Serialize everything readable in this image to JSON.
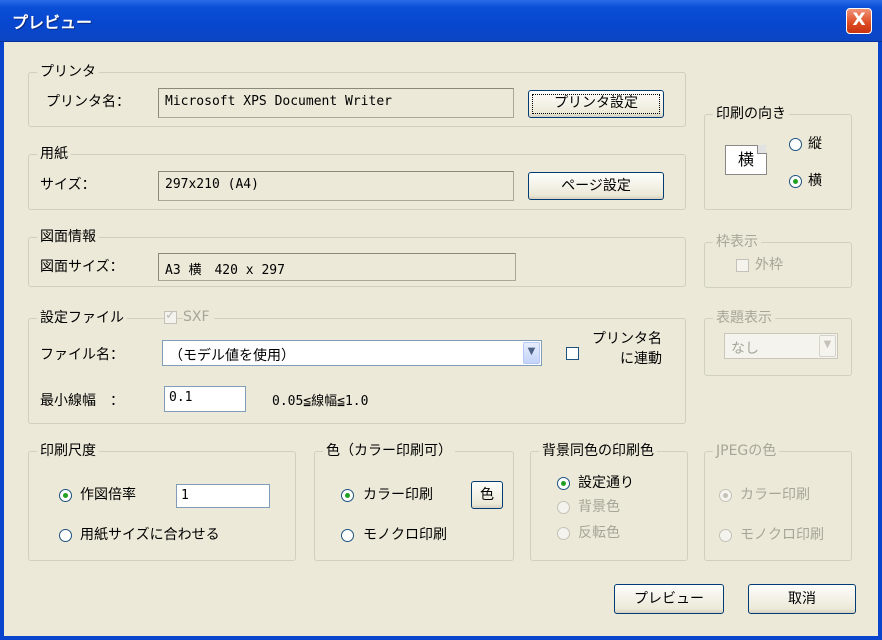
{
  "window": {
    "title": "プレビュー",
    "close_label": "X"
  },
  "printer": {
    "legend": "プリンタ",
    "name_label": "プリンタ名：",
    "name_value": "Microsoft XPS Document Writer",
    "settings_button": "プリンタ設定"
  },
  "paper": {
    "legend": "用紙",
    "size_label": "サイズ：",
    "size_value": "297x210 (A4)",
    "page_setup_button": "ページ設定"
  },
  "orientation": {
    "legend": "印刷の向き",
    "icon_char": "横",
    "portrait_label": "縦",
    "landscape_label": "横",
    "selected": "landscape"
  },
  "drawing_info": {
    "legend": "図面情報",
    "size_label": "図面サイズ：",
    "size_value": "A3 横　420 x 297"
  },
  "frame": {
    "legend": "枠表示",
    "outer_frame_label": "外枠",
    "outer_frame_checked": false
  },
  "settings_file": {
    "legend": "設定ファイル",
    "sxf_label": "SXF",
    "sxf_checked": true,
    "file_label": "ファイル名：",
    "file_value": "（モデル値を使用）",
    "link_printer_label_line1": "プリンタ名",
    "link_printer_label_line2": "に連動",
    "link_printer_checked": false,
    "min_width_label": "最小線幅　：",
    "min_width_value": "0.1",
    "min_width_range": "0.05≦線幅≦1.0"
  },
  "title_display": {
    "legend": "表題表示",
    "selected": "なし"
  },
  "scale": {
    "legend": "印刷尺度",
    "ratio_label": "作図倍率",
    "ratio_value": "1",
    "fit_label": "用紙サイズに合わせる",
    "selected": "ratio"
  },
  "color": {
    "legend": "色（カラー印刷可）",
    "color_label": "カラー印刷",
    "color_button": "色",
    "mono_label": "モノクロ印刷",
    "selected": "color"
  },
  "bg_color": {
    "legend": "背景同色の印刷色",
    "opt1": "設定通り",
    "opt2": "背景色",
    "opt3": "反転色",
    "selected": "opt1"
  },
  "jpeg_color": {
    "legend": "JPEGの色",
    "color_label": "カラー印刷",
    "mono_label": "モノクロ印刷"
  },
  "footer": {
    "preview_button": "プレビュー",
    "cancel_button": "取消"
  }
}
